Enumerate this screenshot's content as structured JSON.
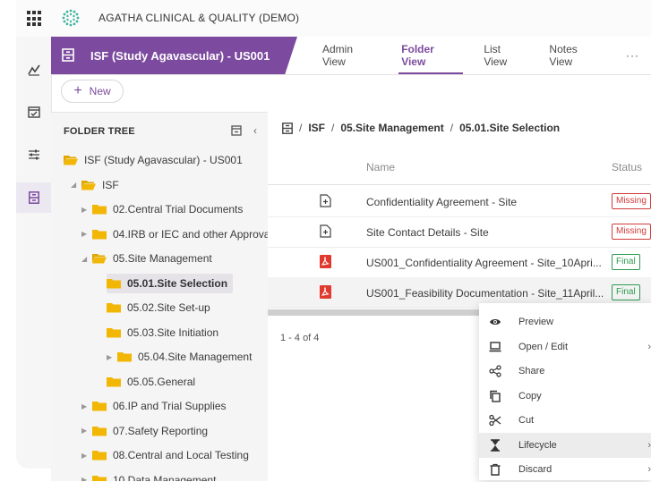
{
  "app": {
    "title": "AGATHA CLINICAL & QUALITY (DEMO)"
  },
  "header": {
    "study": "ISF (Study Agavascular) - US001",
    "tabs": [
      {
        "label": "Admin View",
        "active": false
      },
      {
        "label": "Folder View",
        "active": true
      },
      {
        "label": "List View",
        "active": false
      },
      {
        "label": "Notes View",
        "active": false
      },
      {
        "label": "···",
        "active": false
      }
    ]
  },
  "toolbar": {
    "new_label": "New"
  },
  "tree": {
    "heading": "FOLDER TREE",
    "nodes": [
      {
        "label": "ISF (Study Agavascular) - US001",
        "level": 0,
        "caret": "",
        "open": true
      },
      {
        "label": "ISF",
        "level": 1,
        "caret": "◢",
        "open": true
      },
      {
        "label": "02.Central Trial Documents",
        "level": 2,
        "caret": "▶",
        "open": false
      },
      {
        "label": "04.IRB or IEC and other Approva",
        "level": 2,
        "caret": "▶",
        "open": false
      },
      {
        "label": "05.Site Management",
        "level": 2,
        "caret": "◢",
        "open": true
      },
      {
        "label": "05.01.Site Selection",
        "level": 3,
        "caret": "",
        "open": false,
        "selected": true
      },
      {
        "label": "05.02.Site Set-up",
        "level": 3,
        "caret": "",
        "open": false
      },
      {
        "label": "05.03.Site Initiation",
        "level": 3,
        "caret": "",
        "open": false
      },
      {
        "label": "05.04.Site Management",
        "level": 3,
        "caret": "▶",
        "open": false
      },
      {
        "label": "05.05.General",
        "level": 3,
        "caret": "",
        "open": false
      },
      {
        "label": "06.IP and Trial Supplies",
        "level": 2,
        "caret": "▶",
        "open": false
      },
      {
        "label": "07.Safety Reporting",
        "level": 2,
        "caret": "▶",
        "open": false
      },
      {
        "label": "08.Central and Local Testing",
        "level": 2,
        "caret": "▶",
        "open": false
      },
      {
        "label": "10.Data Management",
        "level": 2,
        "caret": "▶",
        "open": false
      }
    ]
  },
  "breadcrumb": {
    "parts": [
      "ISF",
      "05.Site Management",
      "05.01.Site Selection"
    ]
  },
  "grid": {
    "columns": {
      "name": "Name",
      "status": "Status"
    },
    "rows": [
      {
        "name": "Confidentiality Agreement - Site",
        "status": "Missing",
        "icon": "document-placeholder-icon"
      },
      {
        "name": "Site Contact Details - Site",
        "status": "Missing",
        "icon": "document-placeholder-icon"
      },
      {
        "name": "US001_Confidentiality Agreement - Site_10Apri...",
        "status": "Final",
        "icon": "pdf-icon"
      },
      {
        "name": "US001_Feasibility Documentation - Site_11April...",
        "status": "Final",
        "icon": "pdf-icon"
      }
    ],
    "pager": "1 - 4 of 4"
  },
  "context_menu": {
    "items": [
      {
        "label": "Preview",
        "icon": "eye-icon",
        "submenu": false
      },
      {
        "label": "Open / Edit",
        "icon": "laptop-icon",
        "submenu": true
      },
      {
        "label": "Share",
        "icon": "share-icon",
        "submenu": false
      },
      {
        "label": "Copy",
        "icon": "copy-icon",
        "submenu": false
      },
      {
        "label": "Cut",
        "icon": "scissors-icon",
        "submenu": false
      },
      {
        "label": "Lifecycle",
        "icon": "hourglass-icon",
        "submenu": true,
        "active": true
      },
      {
        "label": "Discard",
        "icon": "trash-icon",
        "submenu": true
      }
    ]
  },
  "colors": {
    "accent": "#7c4a9e",
    "missing": "#d23b3b",
    "final": "#2e9a52",
    "folder": "#f2b705"
  }
}
